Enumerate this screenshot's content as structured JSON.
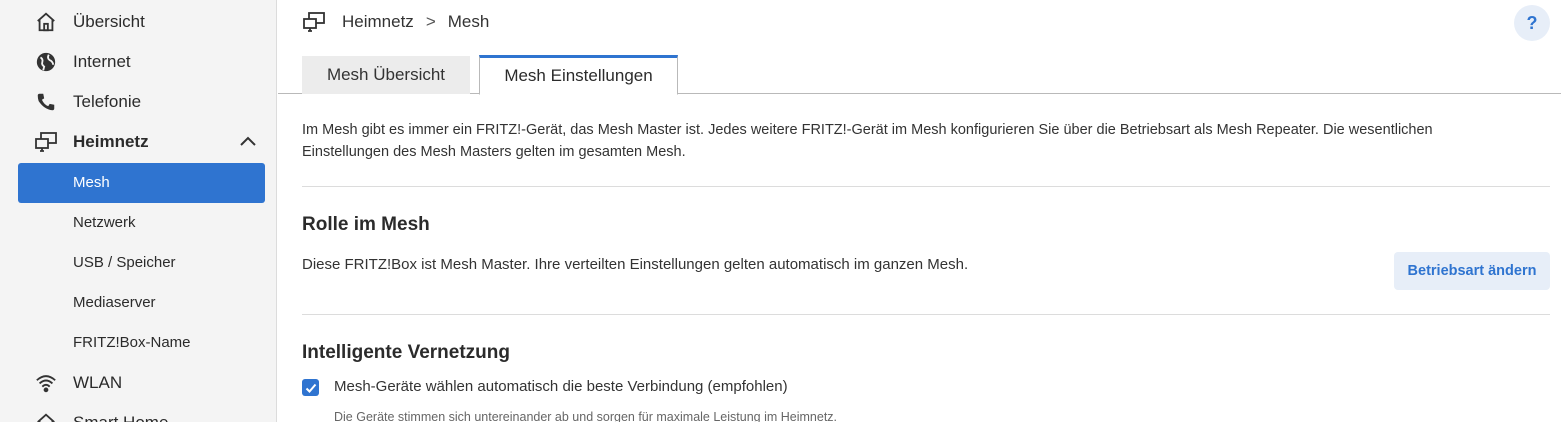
{
  "sidebar": {
    "items": [
      {
        "label": "Übersicht",
        "icon": "home-icon"
      },
      {
        "label": "Internet",
        "icon": "globe-icon"
      },
      {
        "label": "Telefonie",
        "icon": "phone-icon"
      },
      {
        "label": "Heimnetz",
        "icon": "network-icon",
        "expanded": true
      },
      {
        "label": "WLAN",
        "icon": "wifi-icon"
      },
      {
        "label": "Smart Home",
        "icon": "smart-home-icon"
      }
    ],
    "subitems": [
      {
        "label": "Mesh",
        "active": true
      },
      {
        "label": "Netzwerk"
      },
      {
        "label": "USB / Speicher"
      },
      {
        "label": "Mediaserver"
      },
      {
        "label": "FRITZ!Box-Name"
      }
    ]
  },
  "breadcrumb": {
    "root": "Heimnetz",
    "separator": ">",
    "current": "Mesh"
  },
  "help_label": "?",
  "tabs": [
    {
      "label": "Mesh Übersicht",
      "active": false
    },
    {
      "label": "Mesh Einstellungen",
      "active": true
    }
  ],
  "intro": {
    "line1": "Im Mesh gibt es immer ein FRITZ!-Gerät, das Mesh Master ist. Jedes weitere FRITZ!-Gerät im Mesh konfigurieren Sie über die Betriebsart als Mesh Repeater. Die wesentlichen",
    "line2": "Einstellungen des Mesh Masters gelten im gesamten Mesh."
  },
  "role": {
    "title": "Rolle im Mesh",
    "text": "Diese FRITZ!Box ist Mesh Master. Ihre verteilten Einstellungen gelten automatisch im ganzen Mesh.",
    "button": "Betriebsart ändern"
  },
  "smart": {
    "title": "Intelligente Vernetzung",
    "checkbox_label": "Mesh-Geräte wählen automatisch die beste Verbindung (empfohlen)",
    "checked": true,
    "hint": "Die Geräte stimmen sich untereinander ab und sorgen für maximale Leistung im Heimnetz."
  },
  "colors": {
    "accent": "#2f74d0",
    "sidebar_bg": "#f4f4f4",
    "button_bg": "#e7eef8"
  }
}
